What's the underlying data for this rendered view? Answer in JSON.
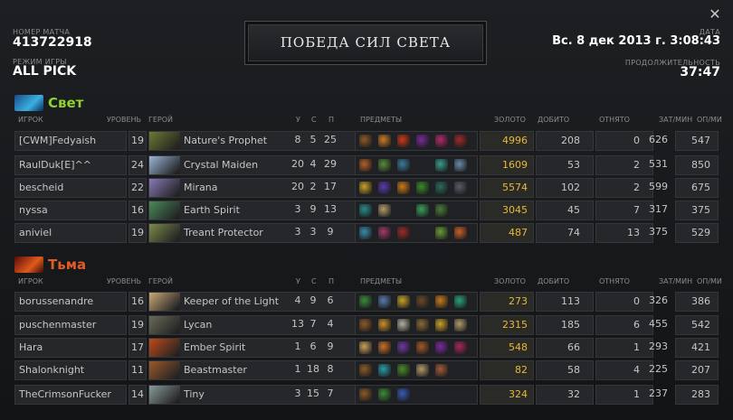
{
  "header": {
    "match_id_label": "НОМЕР МАТЧА",
    "match_id": "413722918",
    "game_mode_label": "РЕЖИМ ИГРЫ",
    "game_mode": "ALL PICK",
    "date_label": "ДАТА",
    "date": "Вс. 8 дек 2013 г. 3:08:43",
    "duration_label": "ПРОДОЛЖИТЕЛЬНОСТЬ",
    "duration": "37:47",
    "result_title": "ПОБЕДА СИЛ СВЕТА",
    "close_icon": "close-icon"
  },
  "columns": {
    "player": "ИГРОК",
    "level": "УРОВЕНЬ",
    "hero": "ГЕРОЙ",
    "kills": "У",
    "deaths": "С",
    "assists": "П",
    "items": "ПРЕДМЕТЫ",
    "gold": "ЗОЛОТО",
    "last_hits": "ДОБИТО",
    "denies": "ОТНЯТО",
    "xpm": "ЗАТ/МИН",
    "gpm": "ОП/МИ"
  },
  "teams": [
    {
      "name": "Свет",
      "color": "#8fd132",
      "icon": "radiant-tree-icon",
      "players": [
        {
          "player": "[CWM]Fedyaish",
          "level": "19",
          "hero": "Nature's Prophet",
          "portrait": "#6b7a32",
          "kills": "8",
          "deaths": "5",
          "assists": "25",
          "items": [
            "#8a5a2a",
            "#c87a2a",
            "#c83a1a",
            "#7a2a9a",
            "#b02a6a",
            "#9a2a2a"
          ],
          "gold": "4996",
          "last_hits": "208",
          "denies": "0",
          "xpm": "626",
          "gpm": "547"
        },
        {
          "player": "RaulDuk[E]^^",
          "level": "24",
          "hero": "Crystal Maiden",
          "portrait": "#9ab6d8",
          "kills": "20",
          "deaths": "4",
          "assists": "29",
          "items": [
            "#b0602a",
            "#5a8a3a",
            "#3a7a9a",
            "",
            "#3a9a8a",
            "#6a8aa8"
          ],
          "gold": "1609",
          "last_hits": "53",
          "denies": "2",
          "xpm": "531",
          "gpm": "850"
        },
        {
          "player": "bescheid",
          "level": "22",
          "hero": "Mirana",
          "portrait": "#8a7ab8",
          "kills": "20",
          "deaths": "2",
          "assists": "17",
          "items": [
            "#c8a02a",
            "#5a3ab0",
            "#c87a1a",
            "#3a8a2a",
            "#2a6a5a",
            "#5a5a6a"
          ],
          "gold": "5574",
          "last_hits": "102",
          "denies": "2",
          "xpm": "599",
          "gpm": "675"
        },
        {
          "player": "nyssa",
          "level": "16",
          "hero": "Earth Spirit",
          "portrait": "#4a8a5a",
          "kills": "3",
          "deaths": "9",
          "assists": "13",
          "items": [
            "#2a8a8a",
            "#b09a6a",
            "",
            "#3aa05a",
            "#4a7a3a",
            ""
          ],
          "gold": "3045",
          "last_hits": "45",
          "denies": "7",
          "xpm": "317",
          "gpm": "375"
        },
        {
          "player": "aniviel",
          "level": "19",
          "hero": "Treant Protector",
          "portrait": "#7a8a4a",
          "kills": "3",
          "deaths": "3",
          "assists": "9",
          "items": [
            "#3a8aaa",
            "#a03a6a",
            "#9a2a2a",
            "",
            "#6a9a3a",
            "#c8602a"
          ],
          "gold": "487",
          "last_hits": "74",
          "denies": "13",
          "xpm": "375",
          "gpm": "529"
        }
      ]
    },
    {
      "name": "Тьма",
      "color": "#e05a2a",
      "icon": "dire-castle-icon",
      "players": [
        {
          "player": "borussenandre",
          "level": "16",
          "hero": "Keeper of the Light",
          "portrait": "#c8a878",
          "kills": "4",
          "deaths": "9",
          "assists": "6",
          "items": [
            "#3a8a3a",
            "#5a7aaa",
            "#c8a02a",
            "#6a4a2a",
            "#c87a1a",
            "#2aa07a"
          ],
          "gold": "273",
          "last_hits": "113",
          "denies": "0",
          "xpm": "326",
          "gpm": "386"
        },
        {
          "player": "puschenmaster",
          "level": "19",
          "hero": "Lycan",
          "portrait": "#6a6a5a",
          "kills": "13",
          "deaths": "7",
          "assists": "4",
          "items": [
            "#8a5a2a",
            "#c8902a",
            "#b0b0a0",
            "#8a6a3a",
            "#c8a02a",
            "#b09a6a"
          ],
          "gold": "2315",
          "last_hits": "185",
          "denies": "6",
          "xpm": "455",
          "gpm": "542"
        },
        {
          "player": "Hara",
          "level": "17",
          "hero": "Ember Spirit",
          "portrait": "#c04a1a",
          "kills": "1",
          "deaths": "6",
          "assists": "9",
          "items": [
            "#c8a05a",
            "#c8702a",
            "#6a3aa0",
            "#a05a2a",
            "#7a2a9a",
            "#a02a5a"
          ],
          "gold": "548",
          "last_hits": "66",
          "denies": "1",
          "xpm": "293",
          "gpm": "421"
        },
        {
          "player": "Shalonknight",
          "level": "11",
          "hero": "Beastmaster",
          "portrait": "#9a5a2a",
          "kills": "1",
          "deaths": "18",
          "assists": "8",
          "items": [
            "#8a5a2a",
            "#2a9aaa",
            "#4a8a2a",
            "#b09a6a",
            "#a05a3a",
            ""
          ],
          "gold": "82",
          "last_hits": "58",
          "denies": "4",
          "xpm": "225",
          "gpm": "207"
        },
        {
          "player": "TheCrimsonFucker",
          "level": "14",
          "hero": "Tiny",
          "portrait": "#8a9a9a",
          "kills": "3",
          "deaths": "15",
          "assists": "7",
          "items": [
            "#8a5a2a",
            "#3a8a3a",
            "#3a5ab0",
            "",
            "",
            ""
          ],
          "gold": "324",
          "last_hits": "32",
          "denies": "1",
          "xpm": "237",
          "gpm": "283"
        }
      ]
    }
  ]
}
